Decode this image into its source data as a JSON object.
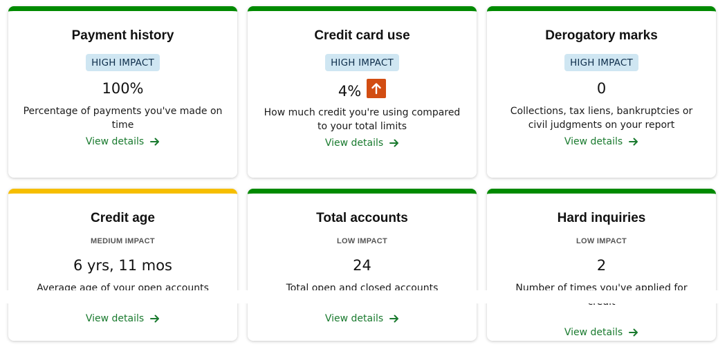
{
  "cards": [
    {
      "title": "Payment history",
      "impact": "HIGH IMPACT",
      "value": "100%",
      "description": "Percentage of payments you've made on time",
      "link": "View details",
      "status_color": "#008a00"
    },
    {
      "title": "Credit card use",
      "impact": "HIGH IMPACT",
      "value": "4%",
      "trend_icon": "arrow-up-icon",
      "description": "How much credit you're using compared to your total limits",
      "link": "View details",
      "status_color": "#008a00"
    },
    {
      "title": "Derogatory marks",
      "impact": "HIGH IMPACT",
      "value": "0",
      "description": "Collections, tax liens, bankruptcies or civil judgments on your report",
      "link": "View details",
      "status_color": "#008a00"
    },
    {
      "title": "Credit age",
      "impact": "MEDIUM IMPACT",
      "value": "6 yrs, 11 mos",
      "description": "Average age of your open accounts",
      "link": "View details",
      "status_color": "#f6be00"
    },
    {
      "title": "Total accounts",
      "impact": "LOW IMPACT",
      "value": "24",
      "description": "Total open and closed accounts",
      "link": "View details",
      "status_color": "#008a00"
    },
    {
      "title": "Hard inquiries",
      "impact": "LOW IMPACT",
      "value": "2",
      "description": "Number of times you've applied for credit",
      "link": "View details",
      "status_color": "#008a00"
    }
  ],
  "colors": {
    "good": "#008a00",
    "fair": "#f6be00",
    "trend_up": "#d24d12",
    "link": "#197a2e",
    "high_badge_bg": "#cfe6f2"
  }
}
